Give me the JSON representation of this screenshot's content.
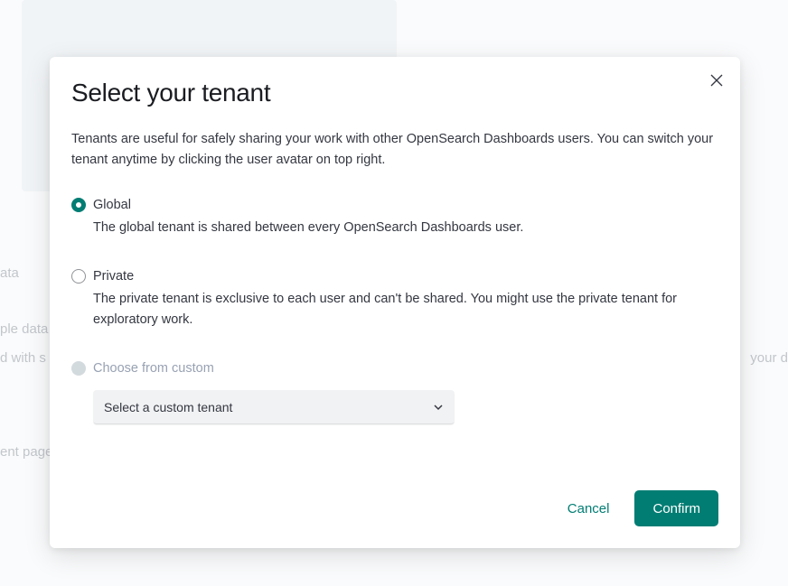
{
  "background": {
    "text_left_1": "ata",
    "text_left_2": "ple data",
    "text_left_3": "d with s",
    "text_left_4": "ent page",
    "text_right": "your d"
  },
  "modal": {
    "title": "Select your tenant",
    "description": "Tenants are useful for safely sharing your work with other OpenSearch Dashboards users. You can switch your tenant anytime by clicking the user avatar on top right.",
    "options": {
      "global": {
        "label": "Global",
        "desc": "The global tenant is shared between every OpenSearch Dashboards user."
      },
      "private": {
        "label": "Private",
        "desc": "The private tenant is exclusive to each user and can't be shared. You might use the private tenant for exploratory work."
      },
      "custom": {
        "label": "Choose from custom",
        "select_placeholder": "Select a custom tenant"
      }
    },
    "buttons": {
      "cancel": "Cancel",
      "confirm": "Confirm"
    }
  }
}
